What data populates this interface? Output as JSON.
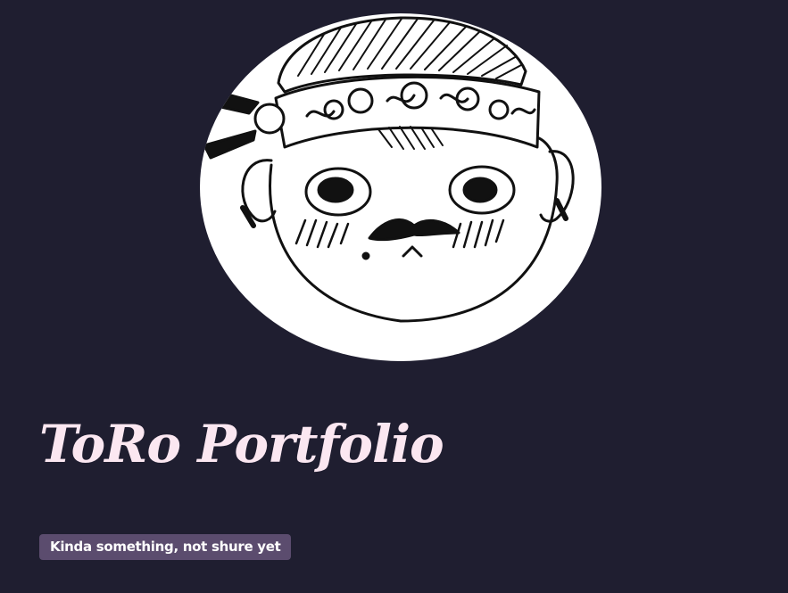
{
  "profile": {
    "title": "ToRo Portfolio",
    "tagline": "Kinda something, not shure yet",
    "avatar_icon": "cartoon-face-with-bandana-avatar"
  },
  "colors": {
    "background": "#1f1e30",
    "title_text": "#fbe7f1",
    "tagline_background": "#5b4c6e",
    "tagline_text": "#ffffff",
    "avatar_background": "#ffffff",
    "ink": "#111111"
  }
}
